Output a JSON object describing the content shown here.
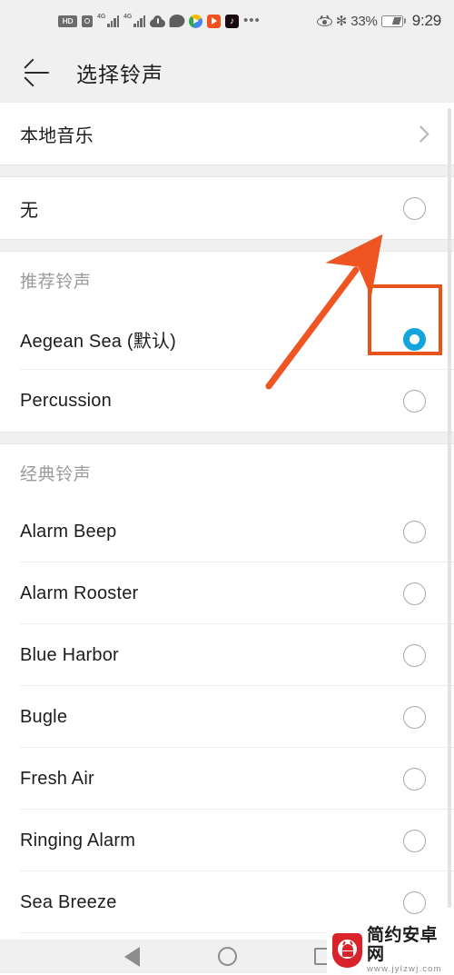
{
  "status_bar": {
    "left_icons": [
      {
        "name": "hd-icon",
        "glyph": "HD"
      },
      {
        "name": "alarm-icon",
        "glyph": ""
      },
      {
        "name": "signal-4g-sim1-icon",
        "glyph": "4G"
      },
      {
        "name": "signal-4g-sim2-icon",
        "glyph": "4G"
      },
      {
        "name": "cloud-alert-icon",
        "glyph": ""
      },
      {
        "name": "chat-bubble-icon",
        "glyph": ""
      },
      {
        "name": "play-store-icon",
        "glyph": ""
      },
      {
        "name": "video-app-icon",
        "glyph": ""
      },
      {
        "name": "tiktok-icon",
        "glyph": "♪"
      },
      {
        "name": "more-icons-ellipsis",
        "glyph": "•••"
      }
    ],
    "eye_comfort_icon": "eye-comfort-icon",
    "bluetooth_glyph": "✻",
    "battery_percent": "33%",
    "time": "9:29"
  },
  "app_bar": {
    "back_label": "back-arrow",
    "title": "选择铃声"
  },
  "list": [
    {
      "type": "group",
      "rows": [
        {
          "label": "本地音乐",
          "control": "chevron",
          "name": "list-item-local-music"
        }
      ]
    },
    {
      "type": "group",
      "rows": [
        {
          "label": "无",
          "control": "radio",
          "selected": false,
          "name": "list-item-none",
          "highlighted": true
        }
      ]
    },
    {
      "type": "section",
      "header": "推荐铃声",
      "rows": [
        {
          "label": "Aegean Sea (默认)",
          "control": "radio",
          "selected": true,
          "name": "list-item-aegean-sea"
        },
        {
          "label": "Percussion",
          "control": "radio",
          "selected": false,
          "name": "list-item-percussion"
        }
      ]
    },
    {
      "type": "section",
      "header": "经典铃声",
      "rows": [
        {
          "label": "Alarm Beep",
          "control": "radio",
          "selected": false,
          "name": "list-item-alarm-beep"
        },
        {
          "label": "Alarm Rooster",
          "control": "radio",
          "selected": false,
          "name": "list-item-alarm-rooster"
        },
        {
          "label": "Blue Harbor",
          "control": "radio",
          "selected": false,
          "name": "list-item-blue-harbor"
        },
        {
          "label": "Bugle",
          "control": "radio",
          "selected": false,
          "name": "list-item-bugle"
        },
        {
          "label": "Fresh Air",
          "control": "radio",
          "selected": false,
          "name": "list-item-fresh-air"
        },
        {
          "label": "Ringing Alarm",
          "control": "radio",
          "selected": false,
          "name": "list-item-ringing-alarm"
        },
        {
          "label": "Sea Breeze",
          "control": "radio",
          "selected": false,
          "name": "list-item-sea-breeze"
        }
      ]
    }
  ],
  "annotation": {
    "highlight_color": "#e8531c",
    "arrow_color": "#ee5522"
  },
  "colors": {
    "selected_radio": "#12a5db",
    "header_bg": "#f0f0f0",
    "text_primary": "#1d1d1d",
    "text_secondary": "#9b9b9b"
  },
  "nav_bar": {
    "back": "nav-back-button",
    "home": "nav-home-button",
    "recents": "nav-recents-button"
  },
  "watermark": {
    "title": "简约安卓网",
    "url": "www.jylzwj.com"
  }
}
